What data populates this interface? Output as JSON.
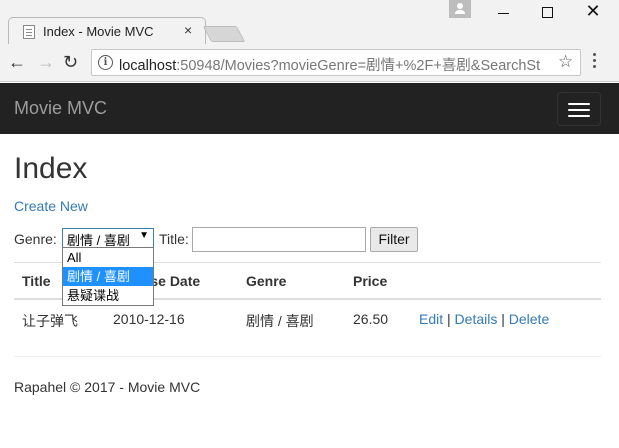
{
  "browser": {
    "tab_title": "Index - Movie MVC",
    "tab_close": "×",
    "url_host": "localhost",
    "url_rest": ":50948/Movies?movieGenre=剧情+%2F+喜剧&SearchSt",
    "window_min": "",
    "window_max": "",
    "window_close": "✕"
  },
  "navbar": {
    "brand": "Movie MVC"
  },
  "page": {
    "title": "Index",
    "create_link": "Create New"
  },
  "filter": {
    "genre_label": "Genre:",
    "genre_selected": "剧情 / 喜剧",
    "genre_options": [
      "All",
      "剧情 / 喜剧",
      "悬疑谍战"
    ],
    "title_label": "Title:",
    "title_value": "",
    "filter_button": "Filter"
  },
  "table": {
    "headers": [
      "Title",
      "Release Date",
      "Genre",
      "Price"
    ],
    "rows": [
      {
        "title": "让子弹飞",
        "release_date": "2010-12-16",
        "genre": "剧情 / 喜剧",
        "price": "26.50",
        "actions": [
          "Edit",
          "Details",
          "Delete"
        ]
      }
    ]
  },
  "footer": {
    "text": "Rapahel © 2017 - Movie MVC"
  }
}
